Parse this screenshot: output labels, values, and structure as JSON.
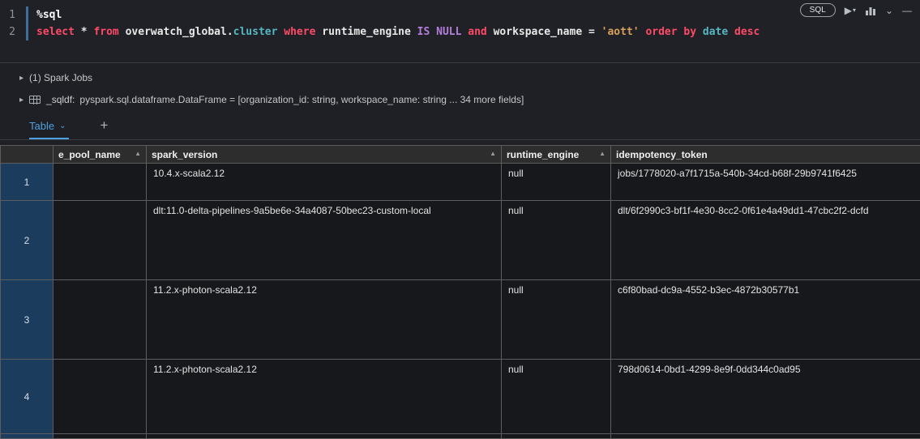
{
  "palette": {
    "keyword_red": "#ff4a67",
    "builtin_purple": "#b57edc",
    "string_orange": "#d9a05b",
    "type_cyan": "#56b6c2",
    "tab_blue": "#4ea1e0",
    "row_gutter_blue": "#1c3c5e"
  },
  "cell_toolbar": {
    "language_badge": "SQL",
    "run_glyph": "▶",
    "run_caret_glyph": "▾",
    "chevron_glyph": "⌄",
    "minimize_glyph": "—"
  },
  "editor": {
    "lines": [
      {
        "number": "1",
        "tokens": [
          {
            "text": "%sql",
            "style": "magic"
          }
        ]
      },
      {
        "number": "2",
        "tokens": [
          {
            "text": "select",
            "style": "kw"
          },
          {
            "text": " * ",
            "style": "plain"
          },
          {
            "text": "from",
            "style": "kw"
          },
          {
            "text": " overwatch_global.",
            "style": "plain"
          },
          {
            "text": "cluster",
            "style": "type"
          },
          {
            "text": " ",
            "style": "plain"
          },
          {
            "text": "where",
            "style": "kw"
          },
          {
            "text": " runtime_engine ",
            "style": "plain"
          },
          {
            "text": "IS",
            "style": "builtin"
          },
          {
            "text": " ",
            "style": "plain"
          },
          {
            "text": "NULL",
            "style": "builtin"
          },
          {
            "text": " ",
            "style": "plain"
          },
          {
            "text": "and",
            "style": "kw"
          },
          {
            "text": " workspace_name = ",
            "style": "plain"
          },
          {
            "text": "'aott'",
            "style": "str"
          },
          {
            "text": " ",
            "style": "plain"
          },
          {
            "text": "order",
            "style": "kw"
          },
          {
            "text": " ",
            "style": "plain"
          },
          {
            "text": "by",
            "style": "kw"
          },
          {
            "text": " ",
            "style": "plain"
          },
          {
            "text": "date",
            "style": "type"
          },
          {
            "text": " ",
            "style": "plain"
          },
          {
            "text": "desc",
            "style": "kw"
          }
        ]
      }
    ]
  },
  "output": {
    "caret_glyph": "▸",
    "spark_jobs_label": "(1) Spark Jobs",
    "sqldf_label": "_sqldf:",
    "sqldf_value": "pyspark.sql.dataframe.DataFrame = [organization_id: string, workspace_name: string ... 34 more fields]"
  },
  "tabs": {
    "active_label": "Table",
    "chevron_glyph": "⌄",
    "add_label": "+"
  },
  "results_table": {
    "sort_glyph": "▲",
    "columns": [
      {
        "label": "e_pool_name",
        "sortable": true
      },
      {
        "label": "spark_version",
        "sortable": true
      },
      {
        "label": "runtime_engine",
        "sortable": true
      },
      {
        "label": "idempotency_token",
        "sortable": false
      }
    ],
    "rows": [
      {
        "n": "1",
        "e_pool_name": "",
        "spark_version": "10.4.x-scala2.12",
        "runtime_engine": "null",
        "idempotency_token": "jobs/1778020-a7f1715a-540b-34cd-b68f-29b9741f6425"
      },
      {
        "n": "2",
        "e_pool_name": "",
        "spark_version": "dlt:11.0-delta-pipelines-9a5be6e-34a4087-50bec23-custom-local",
        "runtime_engine": "null",
        "idempotency_token": "dlt/6f2990c3-bf1f-4e30-8cc2-0f61e4a49dd1-47cbc2f2-dcfd"
      },
      {
        "n": "3",
        "e_pool_name": "",
        "spark_version": "11.2.x-photon-scala2.12",
        "runtime_engine": "null",
        "idempotency_token": "c6f80bad-dc9a-4552-b3ec-4872b30577b1"
      },
      {
        "n": "4",
        "e_pool_name": "",
        "spark_version": "11.2.x-photon-scala2.12",
        "runtime_engine": "null",
        "idempotency_token": "798d0614-0bd1-4299-8e9f-0dd344c0ad95"
      }
    ]
  }
}
